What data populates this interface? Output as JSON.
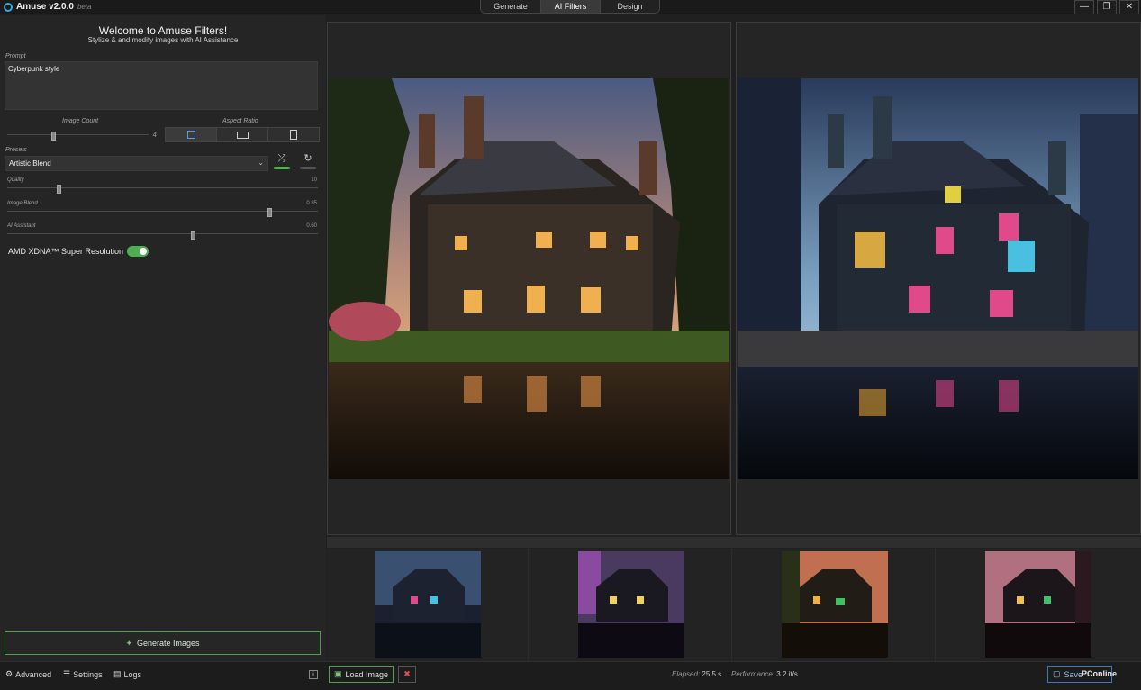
{
  "app": {
    "name": "Amuse v2.0.0",
    "badge": "beta"
  },
  "tabs": [
    {
      "label": "Generate",
      "active": false
    },
    {
      "label": "AI Filters",
      "active": true
    },
    {
      "label": "Design",
      "active": false
    }
  ],
  "window_controls": {
    "minimize": "—",
    "restore": "❐",
    "close": "✕"
  },
  "left": {
    "welcome_title": "Welcome to Amuse Filters!",
    "welcome_subtitle": "Stylize & and modify images with AI Assistance",
    "prompt_label": "Prompt",
    "prompt_value": "Cyberpunk style",
    "image_count_label": "Image Count",
    "image_count_value": "4",
    "aspect_ratio_label": "Aspect Ratio",
    "aspect_options": [
      "square",
      "landscape",
      "portrait"
    ],
    "aspect_selected": "square",
    "presets_label": "Presets",
    "preset_value": "Artistic Blend",
    "quality_label": "Quality",
    "quality_value": "10",
    "image_blend_label": "Image Blend",
    "image_blend_value": "0.85",
    "ai_assistant_label": "AI Assistant",
    "ai_assistant_value": "0.60",
    "super_resolution_label": "AMD XDNA™ Super Resolution",
    "super_resolution_on": true,
    "generate_label": "Generate Images"
  },
  "bottom": {
    "advanced": "Advanced",
    "settings": "Settings",
    "logs": "Logs",
    "load_image": "Load Image",
    "elapsed_label": "Elapsed:",
    "elapsed_value": "25.5 s",
    "performance_label": "Performance:",
    "performance_value": "3.2 it/s",
    "save_label": "Save",
    "watermark": "PConline"
  },
  "colors": {
    "accent_green": "#4caf50",
    "accent_blue": "#3fa8d8",
    "background": "#202020"
  },
  "icons": [
    "amuse-logo-icon",
    "shuffle-icon",
    "refresh-icon",
    "magic-wand-icon",
    "advanced-user-icon",
    "settings-sliders-icon",
    "logs-icon",
    "info-icon",
    "load-image-icon",
    "delete-icon",
    "save-icon"
  ]
}
